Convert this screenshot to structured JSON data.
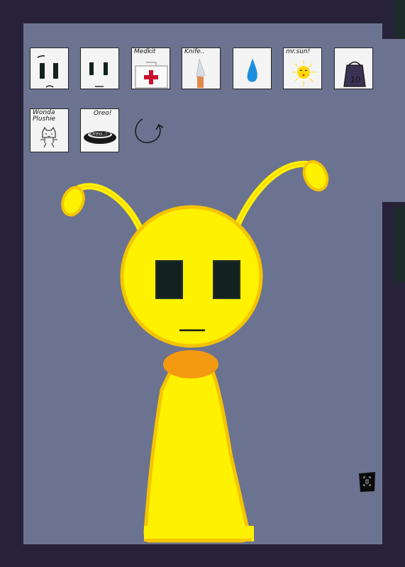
{
  "colors": {
    "background": "#272239",
    "stage": "#6b7390",
    "character_yellow": "#fff200",
    "character_outline": "#f5c400",
    "collar": "#f49a10",
    "eyes": "#13221f",
    "slot_bg": "#f4f4f4"
  },
  "inventory": {
    "row1": [
      {
        "id": "face-frown",
        "label": "",
        "icon": "frown-face-icon"
      },
      {
        "id": "face-neutral",
        "label": "",
        "icon": "neutral-face-icon"
      },
      {
        "id": "medkit",
        "label": "Medkit",
        "icon": "medkit-icon"
      },
      {
        "id": "knife",
        "label": "Knife..",
        "icon": "knife-icon"
      },
      {
        "id": "water",
        "label": "",
        "icon": "water-drop-icon"
      },
      {
        "id": "sun",
        "label": "mr.sun!",
        "icon": "sun-icon"
      },
      {
        "id": "weight",
        "label": "10",
        "icon": "weight-icon"
      }
    ],
    "row2": [
      {
        "id": "plushie",
        "label": "Wonda\nPlushie",
        "icon": "cat-plushie-icon"
      },
      {
        "id": "oreo",
        "label": "Oreo!",
        "icon": "oreo-icon",
        "inner_label": "Oreo..!"
      }
    ]
  },
  "reset_icon": "reset-arrow-icon",
  "corner_icon": "scan-icon"
}
